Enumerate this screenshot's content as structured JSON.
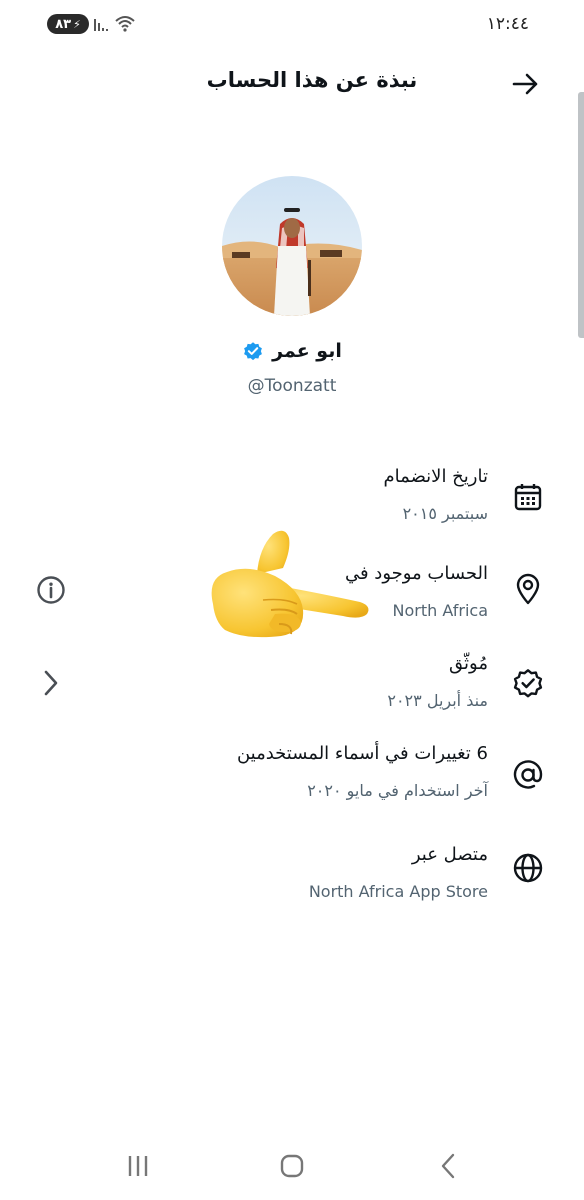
{
  "status_bar": {
    "battery": "٨٣",
    "time": "١٢:٤٤"
  },
  "header": {
    "title": "نبذة عن هذا الحساب"
  },
  "profile": {
    "name": "ابو عمر",
    "handle": "@Toonzatt",
    "verified_color": "#1d9bf0"
  },
  "info_rows": [
    {
      "icon": "calendar-icon",
      "label": "تاريخ الانضمام",
      "value": "سبتمبر ٢٠١٥"
    },
    {
      "icon": "location-pin-icon",
      "label": "الحساب موجود في",
      "value": "North Africa"
    },
    {
      "icon": "verified-badge-icon",
      "label": "مُوثّق",
      "value": "منذ أبريل ٢٠٢٣"
    },
    {
      "icon": "at-sign-icon",
      "label": "6 تغييرات في أسماء المستخدمين",
      "value": "آخر استخدام في مايو ٢٠٢٠"
    },
    {
      "icon": "globe-icon",
      "label": "متصل عبر",
      "value": "North Africa App Store"
    }
  ],
  "side_controls": {
    "info_icon": "info-icon",
    "next_icon": "chevron-right-icon"
  },
  "nav": {
    "recents_icon": "recent-apps-icon",
    "home_icon": "home-icon",
    "back_icon": "back-icon"
  },
  "colors": {
    "text_primary": "#0f1419",
    "text_secondary": "#536471",
    "accent": "#1d9bf0"
  }
}
